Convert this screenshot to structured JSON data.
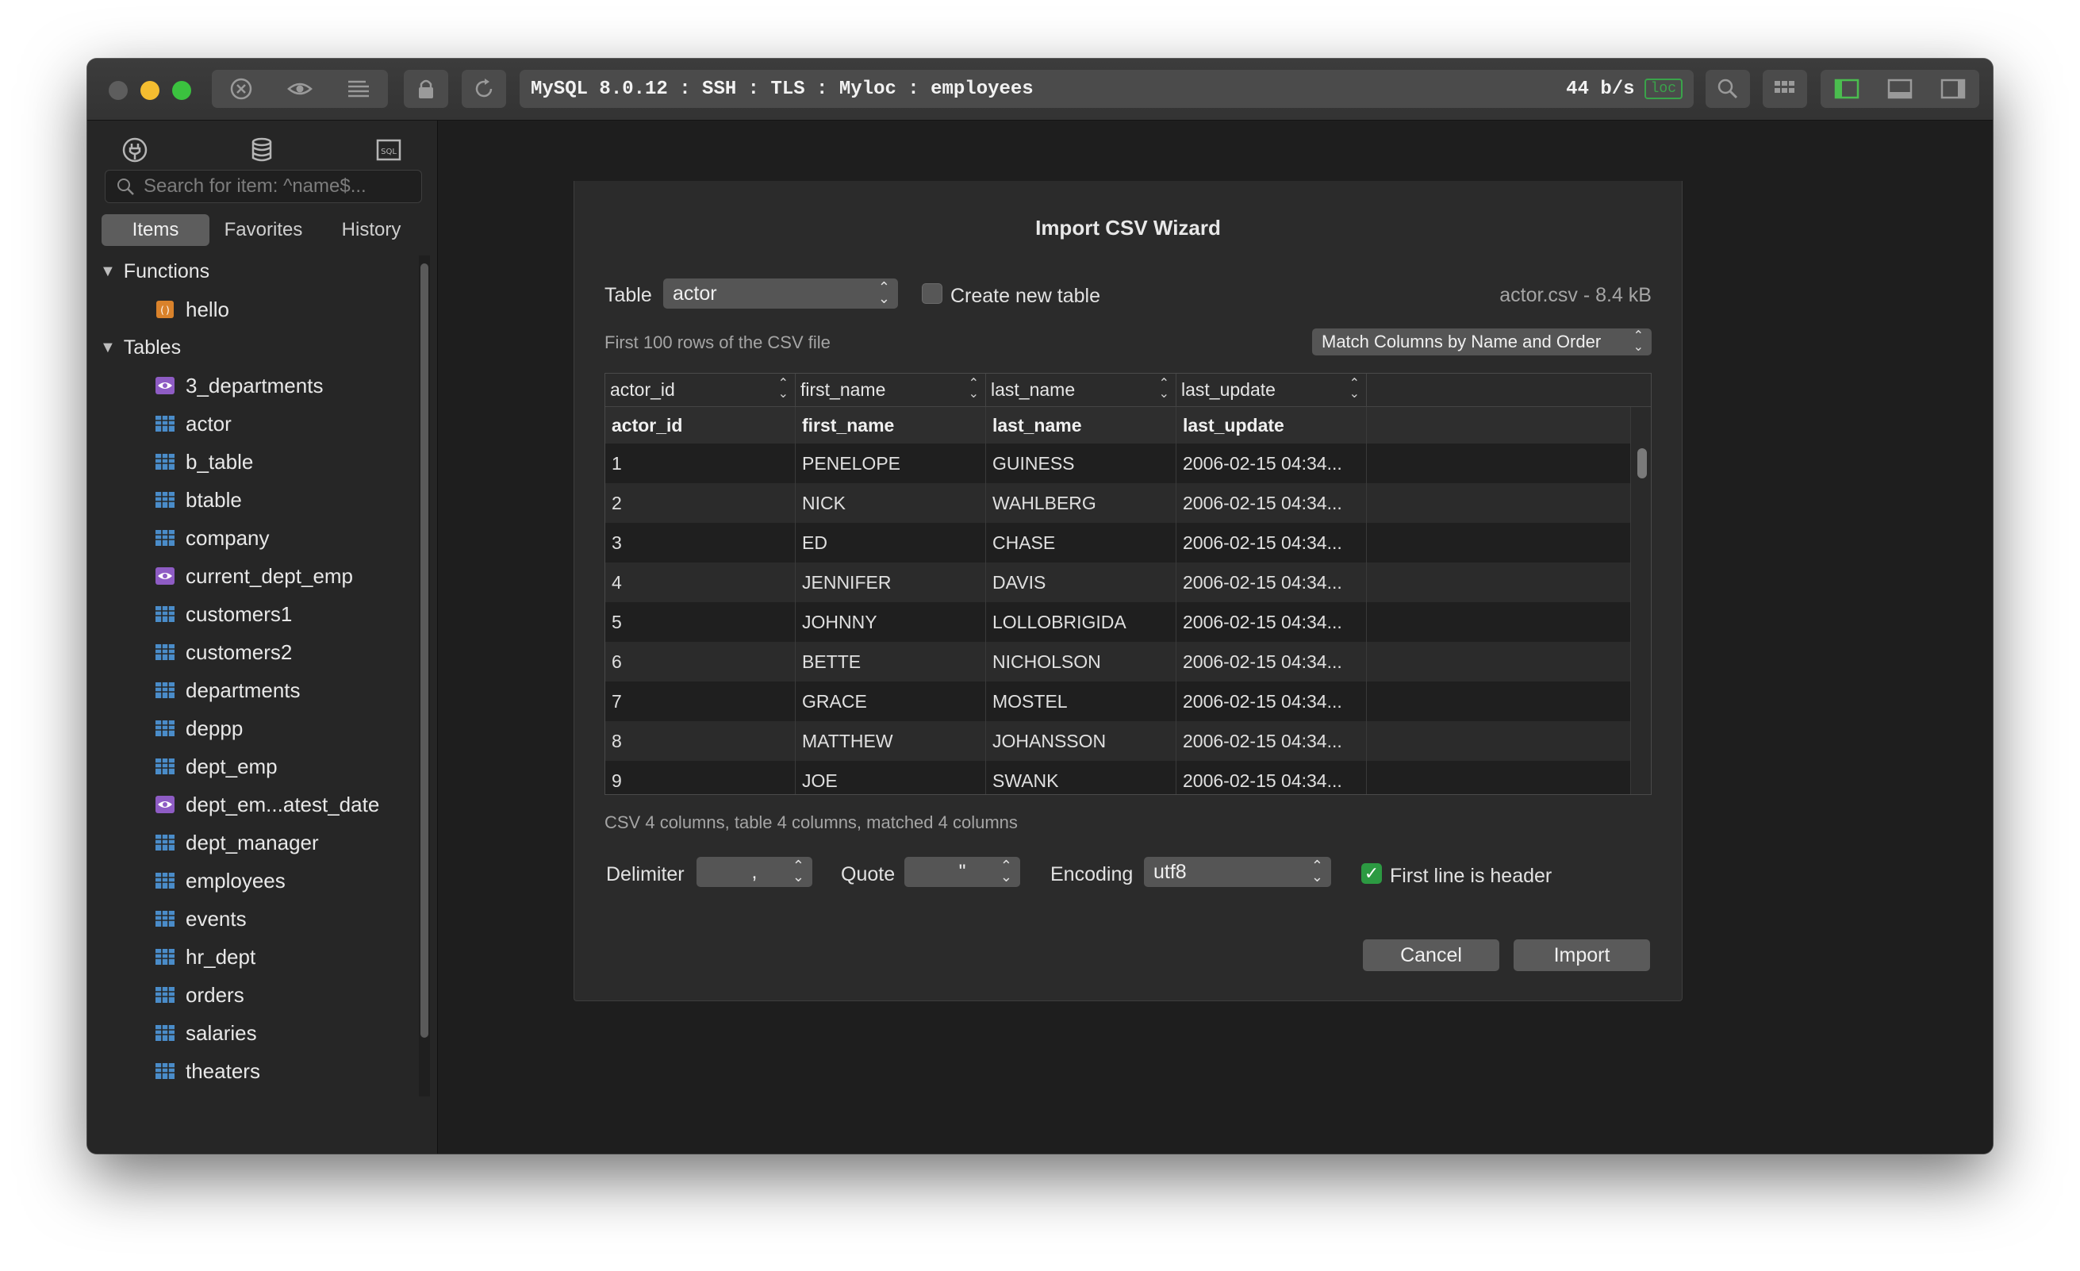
{
  "titlebar": {
    "connection": "MySQL 8.0.12 : SSH : TLS : Myloc : employees",
    "rate": "44 b/s",
    "badge": "loc",
    "traffic_colors": {
      "close": "#5d5d5d",
      "minimize": "#f4bd30",
      "maximize": "#3bc23f"
    }
  },
  "sidebar": {
    "search_placeholder": "Search for item: ^name$...",
    "tabs": [
      "Items",
      "Favorites",
      "History"
    ],
    "groups": {
      "functions": {
        "label": "Functions",
        "items": [
          {
            "label": "hello",
            "icon": "function-icon"
          }
        ]
      },
      "tables": {
        "label": "Tables",
        "items": [
          {
            "label": "3_departments",
            "icon": "view-icon"
          },
          {
            "label": "actor",
            "icon": "table-icon"
          },
          {
            "label": "b_table",
            "icon": "table-icon"
          },
          {
            "label": "btable",
            "icon": "table-icon"
          },
          {
            "label": "company",
            "icon": "table-icon"
          },
          {
            "label": "current_dept_emp",
            "icon": "view-icon"
          },
          {
            "label": "customers1",
            "icon": "table-icon"
          },
          {
            "label": "customers2",
            "icon": "table-icon"
          },
          {
            "label": "departments",
            "icon": "table-icon"
          },
          {
            "label": "deppp",
            "icon": "table-icon"
          },
          {
            "label": "dept_emp",
            "icon": "table-icon"
          },
          {
            "label": "dept_em...atest_date",
            "icon": "view-icon"
          },
          {
            "label": "dept_manager",
            "icon": "table-icon"
          },
          {
            "label": "employees",
            "icon": "table-icon"
          },
          {
            "label": "events",
            "icon": "table-icon"
          },
          {
            "label": "hr_dept",
            "icon": "table-icon"
          },
          {
            "label": "orders",
            "icon": "table-icon"
          },
          {
            "label": "salaries",
            "icon": "table-icon"
          },
          {
            "label": "theaters",
            "icon": "table-icon"
          }
        ]
      }
    },
    "add_label": "+",
    "add_menu": "⌄"
  },
  "dialog": {
    "title": "Import CSV Wizard",
    "table_label": "Table",
    "table_value": "actor",
    "create_new_label": "Create new table",
    "file_info": "actor.csv -  8.4 kB",
    "preview_caption": "First 100 rows of the CSV file",
    "match_mode": "Match Columns by Name and Order",
    "column_mapping": [
      "actor_id",
      "first_name",
      "last_name",
      "last_update"
    ],
    "csv_header": [
      "actor_id",
      "first_name",
      "last_name",
      "last_update"
    ],
    "rows": [
      [
        "1",
        "PENELOPE",
        "GUINESS",
        "2006-02-15 04:34..."
      ],
      [
        "2",
        "NICK",
        "WAHLBERG",
        "2006-02-15 04:34..."
      ],
      [
        "3",
        "ED",
        "CHASE",
        "2006-02-15 04:34..."
      ],
      [
        "4",
        "JENNIFER",
        "DAVIS",
        "2006-02-15 04:34..."
      ],
      [
        "5",
        "JOHNNY",
        "LOLLOBRIGIDA",
        "2006-02-15 04:34..."
      ],
      [
        "6",
        "BETTE",
        "NICHOLSON",
        "2006-02-15 04:34..."
      ],
      [
        "7",
        "GRACE",
        "MOSTEL",
        "2006-02-15 04:34..."
      ],
      [
        "8",
        "MATTHEW",
        "JOHANSSON",
        "2006-02-15 04:34..."
      ],
      [
        "9",
        "JOE",
        "SWANK",
        "2006-02-15 04:34..."
      ]
    ],
    "summary": "CSV 4 columns, table 4 columns, matched 4 columns",
    "delimiter_label": "Delimiter",
    "delimiter_value": ",",
    "quote_label": "Quote",
    "quote_value": "\"",
    "encoding_label": "Encoding",
    "encoding_value": "utf8",
    "first_line_header_label": "First line is header",
    "cancel_label": "Cancel",
    "import_label": "Import",
    "accent_green": "#2c9a42"
  }
}
